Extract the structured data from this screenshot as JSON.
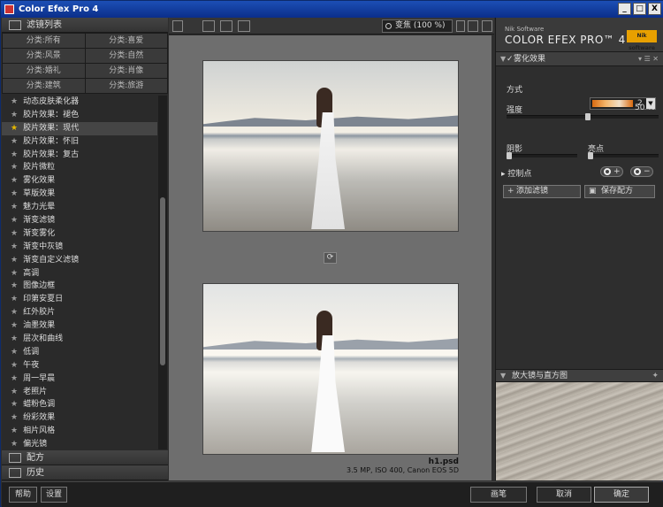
{
  "title": "Color Efex Pro 4",
  "window_buttons": {
    "minimize": "_",
    "maximize": "□",
    "close": "X"
  },
  "left": {
    "filter_list_header": "滤镜列表",
    "categories": [
      "分类:所有",
      "分类:喜爱",
      "分类:风景",
      "分类:自然",
      "分类:婚礼",
      "分类:肖像",
      "分类:建筑",
      "分类:旅游"
    ],
    "filters": [
      {
        "name": "动态皮肤柔化器",
        "selected": false
      },
      {
        "name": "胶片效果：褪色",
        "selected": false
      },
      {
        "name": "胶片效果：现代",
        "selected": true
      },
      {
        "name": "胶片效果：怀旧",
        "selected": false
      },
      {
        "name": "胶片效果：复古",
        "selected": false
      },
      {
        "name": "胶片微粒",
        "selected": false
      },
      {
        "name": "雾化效果",
        "selected": false
      },
      {
        "name": "草版效果",
        "selected": false
      },
      {
        "name": "魅力光晕",
        "selected": false
      },
      {
        "name": "渐变滤镜",
        "selected": false
      },
      {
        "name": "渐变雾化",
        "selected": false
      },
      {
        "name": "渐变中灰镜",
        "selected": false
      },
      {
        "name": "渐变自定义滤镜",
        "selected": false
      },
      {
        "name": "高调",
        "selected": false
      },
      {
        "name": "图像边框",
        "selected": false
      },
      {
        "name": "印第安夏日",
        "selected": false
      },
      {
        "name": "红外胶片",
        "selected": false
      },
      {
        "name": "油墨效果",
        "selected": false
      },
      {
        "name": "层次和曲线",
        "selected": false
      },
      {
        "name": "低调",
        "selected": false
      },
      {
        "name": "午夜",
        "selected": false
      },
      {
        "name": "周一早晨",
        "selected": false
      },
      {
        "name": "老照片",
        "selected": false
      },
      {
        "name": "蜡粉色调",
        "selected": false
      },
      {
        "name": "纷彩效果",
        "selected": false
      },
      {
        "name": "相片风格",
        "selected": false
      },
      {
        "name": "偏光镜",
        "selected": false
      }
    ],
    "recipes": "配方",
    "history": "历史"
  },
  "toolbar": {
    "zoom": "变焦 (100 %)"
  },
  "image": {
    "name": "h1.psd",
    "info": "3.5 MP, ISO 400, Canon EOS 5D"
  },
  "right": {
    "brand_small": "Nik Software",
    "brand_title": "COLOR EFEX PRO™ 4",
    "brand_logo": "Nik software",
    "filter_name": "雾化效果",
    "method_label": "方式",
    "method_value": "2",
    "strength_label": "强度",
    "strength_value": "50 %",
    "strength": 0.5,
    "shadows_label": "阴影",
    "highlights_label": "亮点",
    "control_points": "控制点",
    "add_filter": "添加滤镜",
    "save_recipe": "保存配方",
    "loupe_header": "放大镜与直方图"
  },
  "bottom": {
    "help": "帮助",
    "settings": "设置",
    "brush": "画笔",
    "cancel": "取消",
    "ok": "确定"
  },
  "colors": {
    "titlebar": "#0b2e8a",
    "accent": "#e6b800",
    "method_swatch": "#d86a10"
  }
}
